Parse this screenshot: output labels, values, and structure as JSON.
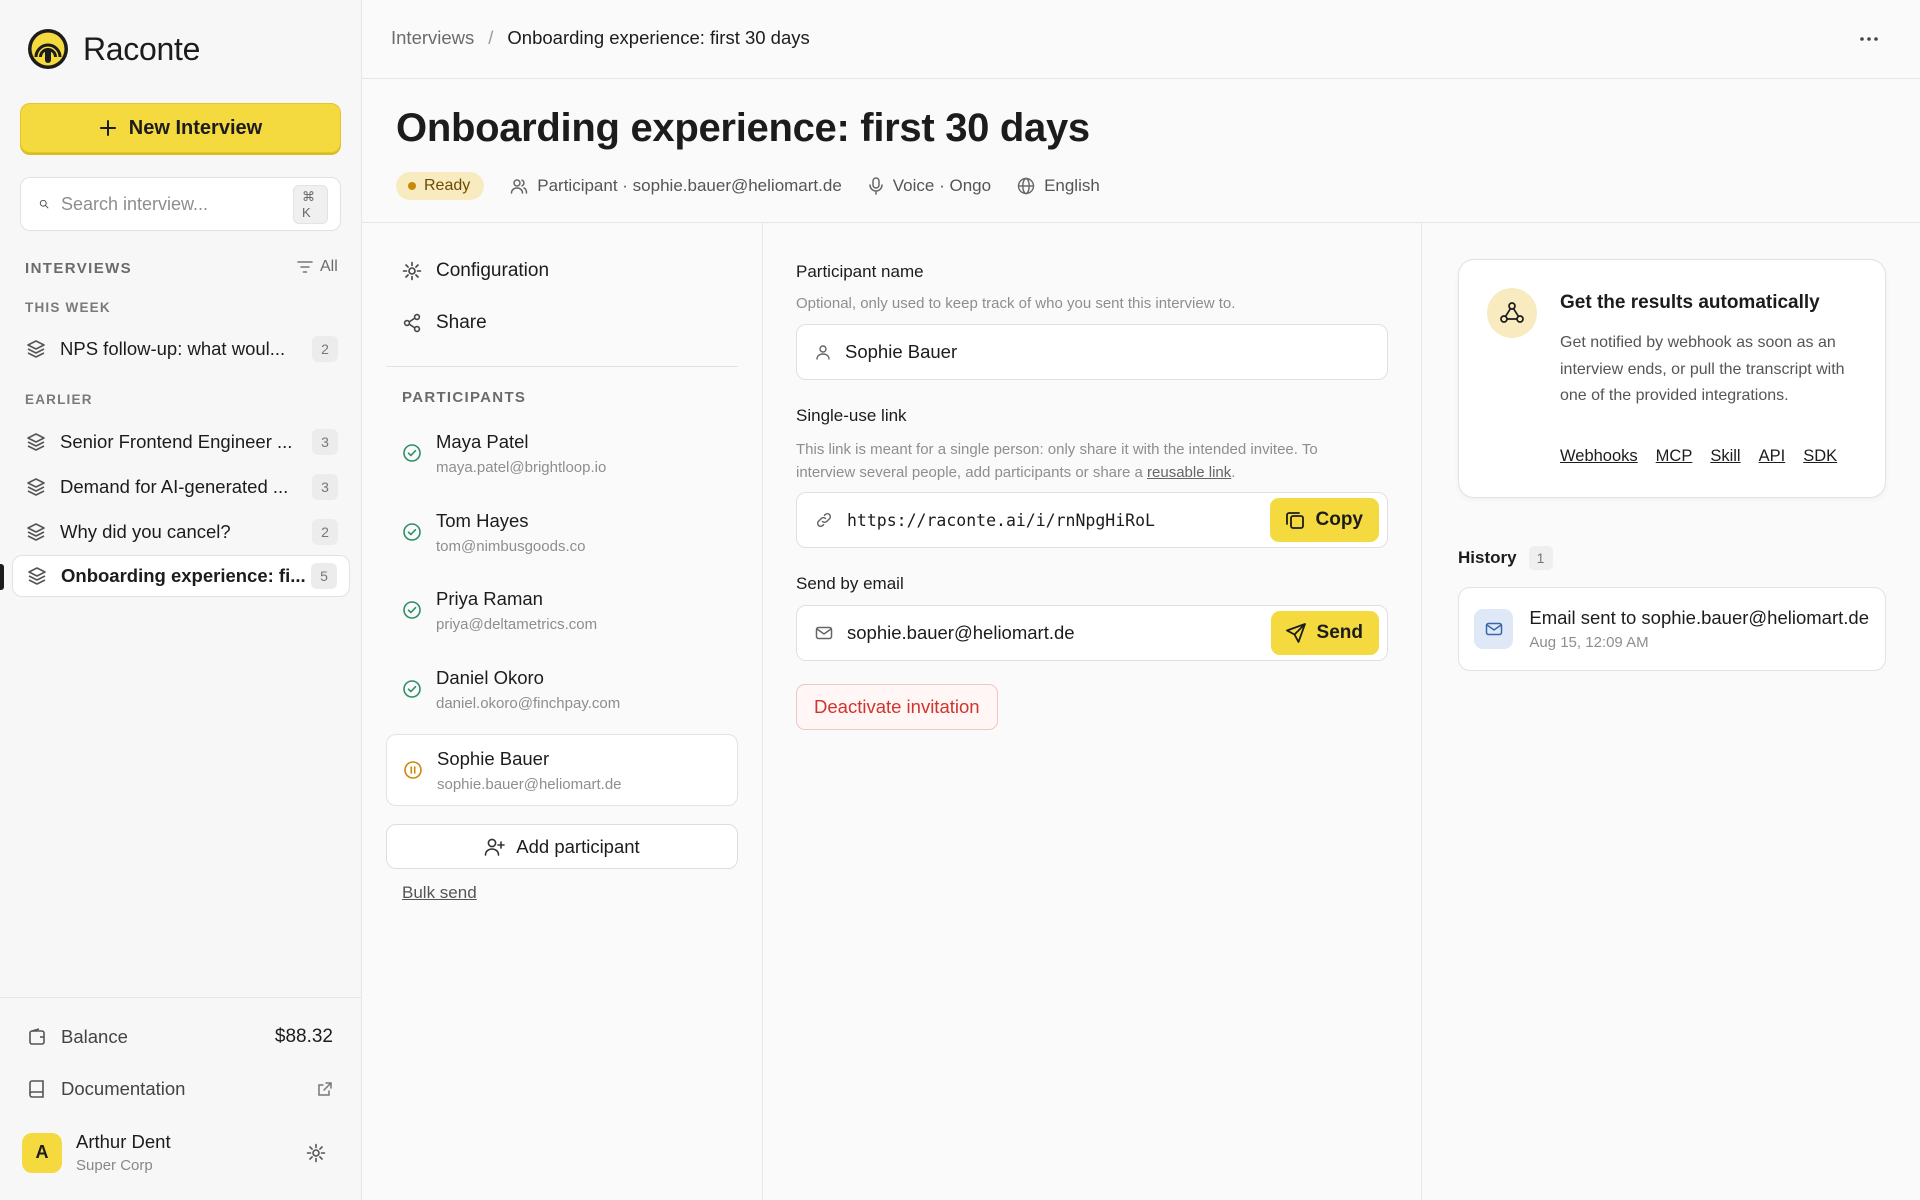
{
  "app": {
    "name": "Raconte"
  },
  "sidebar": {
    "new_button_label": "New Interview",
    "search_placeholder": "Search interview...",
    "search_shortcut": "⌘ K",
    "section_label": "INTERVIEWS",
    "filter_label": "All",
    "groups": [
      {
        "label": "THIS WEEK",
        "items": [
          {
            "label": "NPS follow-up: what woul...",
            "count": "2"
          }
        ]
      },
      {
        "label": "EARLIER",
        "items": [
          {
            "label": "Senior Frontend Engineer ...",
            "count": "3"
          },
          {
            "label": "Demand for AI-generated ...",
            "count": "3"
          },
          {
            "label": "Why did you cancel?",
            "count": "2"
          },
          {
            "label": "Onboarding experience: fi...",
            "count": "5",
            "active": true
          }
        ]
      }
    ],
    "balance_label": "Balance",
    "balance_value": "$88.32",
    "documentation_label": "Documentation",
    "user": {
      "initial": "A",
      "name": "Arthur Dent",
      "org": "Super Corp"
    }
  },
  "breadcrumb": {
    "parent": "Interviews",
    "separator": "/",
    "current": "Onboarding experience: first 30 days"
  },
  "header": {
    "title": "Onboarding experience: first 30 days",
    "status": "Ready",
    "participant_meta": "Participant · sophie.bauer@heliomart.de",
    "voice_meta": "Voice · Ongo",
    "language_meta": "English"
  },
  "left_menu": {
    "configuration": "Configuration",
    "share": "Share"
  },
  "participants": {
    "label": "PARTICIPANTS",
    "items": [
      {
        "name": "Maya Patel",
        "email": "maya.patel@brightloop.io",
        "status": "done"
      },
      {
        "name": "Tom Hayes",
        "email": "tom@nimbusgoods.co",
        "status": "done"
      },
      {
        "name": "Priya Raman",
        "email": "priya@deltametrics.com",
        "status": "done"
      },
      {
        "name": "Daniel Okoro",
        "email": "daniel.okoro@finchpay.com",
        "status": "done"
      },
      {
        "name": "Sophie Bauer",
        "email": "sophie.bauer@heliomart.de",
        "status": "paused"
      }
    ],
    "add_label": "Add participant",
    "bulk_label": "Bulk send"
  },
  "form": {
    "name_label": "Participant name",
    "name_help": "Optional, only used to keep track of who you sent this interview to.",
    "name_value": "Sophie Bauer",
    "link_label": "Single-use link",
    "link_help_1": "This link is meant for a single person: only share it with the intended invitee. To interview several people, add participants or share a ",
    "link_help_link": "reusable link",
    "link_help_2": ".",
    "link_value": "https://raconte.ai/i/rnNpgHiRoL",
    "copy_label": "Copy",
    "email_label": "Send by email",
    "email_value": "sophie.bauer@heliomart.de",
    "send_label": "Send",
    "deactivate_label": "Deactivate invitation"
  },
  "results_card": {
    "title": "Get the results automatically",
    "body": "Get notified by webhook as soon as an interview ends, or pull the transcript with one of the provided integrations.",
    "links": [
      "Webhooks",
      "MCP",
      "Skill",
      "API",
      "SDK"
    ]
  },
  "history": {
    "label": "History",
    "count": "1",
    "items": [
      {
        "text": "Email sent to sophie.bauer@heliomart.de",
        "time": "Aug 15, 12:09 AM"
      }
    ]
  },
  "colors": {
    "accent": "#f4d93f",
    "danger": "#d0352d",
    "success": "#2e8f66",
    "paused": "#c98a08"
  }
}
